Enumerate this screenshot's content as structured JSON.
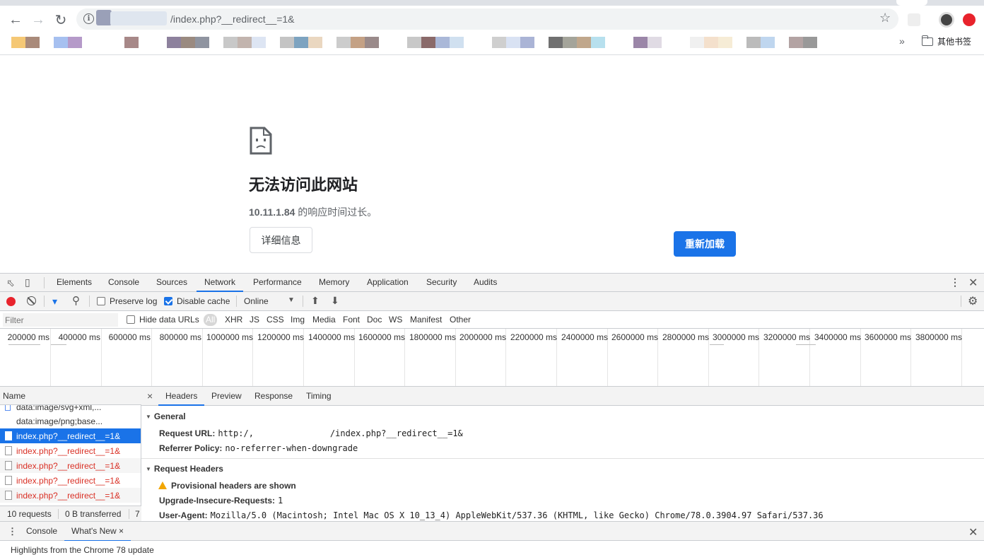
{
  "browser": {
    "url": "/index.php?__redirect__=1&",
    "bookmarks_more": "»",
    "other_bookmarks": "其他书签"
  },
  "error_page": {
    "title": "无法访问此网站",
    "host": "10.11.1.84",
    "message_suffix": " 的响应时间过长。",
    "details_button": "详细信息",
    "reload_button": "重新加载"
  },
  "devtools": {
    "tabs": [
      "Elements",
      "Console",
      "Sources",
      "Network",
      "Performance",
      "Memory",
      "Application",
      "Security",
      "Audits"
    ],
    "active_tab": "Network",
    "toolbar": {
      "preserve_log": "Preserve log",
      "preserve_log_checked": false,
      "disable_cache": "Disable cache",
      "disable_cache_checked": true,
      "throttling": "Online"
    },
    "filter": {
      "placeholder": "Filter",
      "hide_data_urls": "Hide data URLs",
      "types": [
        "All",
        "XHR",
        "JS",
        "CSS",
        "Img",
        "Media",
        "Font",
        "Doc",
        "WS",
        "Manifest",
        "Other"
      ],
      "active_type": "All"
    },
    "timeline_ticks": [
      "200000 ms",
      "400000 ms",
      "600000 ms",
      "800000 ms",
      "1000000 ms",
      "1200000 ms",
      "1400000 ms",
      "1600000 ms",
      "1800000 ms",
      "2000000 ms",
      "2200000 ms",
      "2400000 ms",
      "2600000 ms",
      "2800000 ms",
      "3000000 ms",
      "3200000 ms",
      "3400000 ms",
      "3600000 ms",
      "3800000 ms",
      "4000"
    ],
    "requests_header": "Name",
    "requests": [
      {
        "name": "data:image/svg+xml,...",
        "status": "normal"
      },
      {
        "name": "data:image/png;base...",
        "status": "normal"
      },
      {
        "name": "index.php?__redirect__=1&",
        "status": "selected"
      },
      {
        "name": "index.php?__redirect__=1&",
        "status": "error"
      },
      {
        "name": "index.php?__redirect__=1&",
        "status": "error"
      },
      {
        "name": "index.php?__redirect__=1&",
        "status": "error"
      },
      {
        "name": "index.php?__redirect__=1&",
        "status": "error"
      }
    ],
    "status_bar": {
      "requests": "10 requests",
      "transferred": "0 B transferred",
      "extra": "7"
    },
    "detail_tabs": [
      "Headers",
      "Preview",
      "Response",
      "Timing"
    ],
    "active_detail_tab": "Headers",
    "general": {
      "title": "General",
      "request_url_key": "Request URL:",
      "request_url_scheme": "http:/,",
      "request_url_path": "/index.php?__redirect__=1&",
      "referrer_key": "Referrer Policy:",
      "referrer_value": "no-referrer-when-downgrade"
    },
    "request_headers": {
      "title": "Request Headers",
      "warning": "Provisional headers are shown",
      "upgrade_key": "Upgrade-Insecure-Requests:",
      "upgrade_value": "1",
      "ua_key": "User-Agent:",
      "ua_value": "Mozilla/5.0 (Macintosh; Intel Mac OS X 10_13_4) AppleWebKit/537.36 (KHTML, like Gecko) Chrome/78.0.3904.97 Safari/537.36"
    },
    "drawer": {
      "tabs": [
        "Console",
        "What's New"
      ],
      "active_tab": "What's New",
      "close_tab_glyph": "×",
      "body_text": "Highlights from the Chrome 78 update"
    }
  },
  "colors": {
    "accent": "#1a73e8",
    "error_text": "#d93025",
    "record": "#e8232c"
  }
}
